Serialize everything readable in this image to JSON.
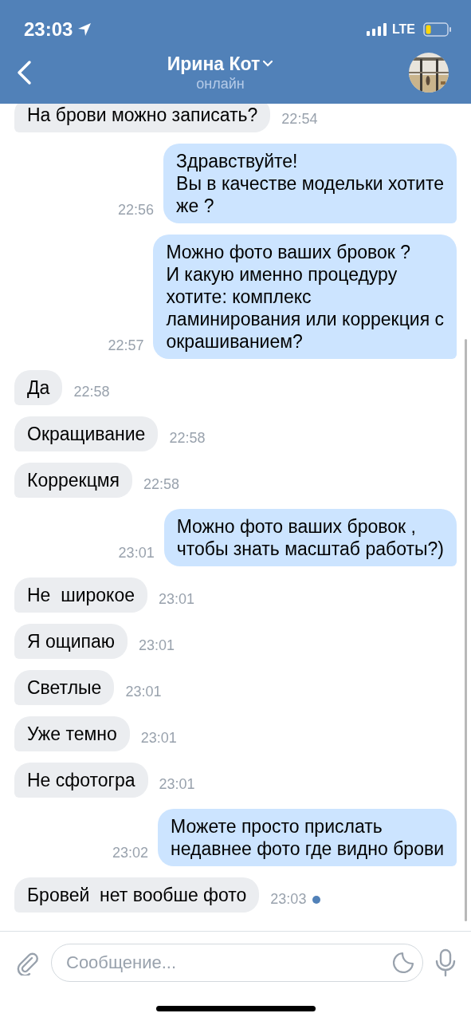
{
  "status_bar": {
    "time": "23:03",
    "network": "LTE"
  },
  "header": {
    "name": "Ирина Кот",
    "status": "онлайн"
  },
  "messages": [
    {
      "kind": "incoming",
      "text": "На брови можно записать?",
      "time": "22:54",
      "unread": false
    },
    {
      "kind": "outgoing",
      "text": "Здравствуйте!\nВы в качестве модельки хотите\nже ?",
      "time": "22:56",
      "unread": false
    },
    {
      "kind": "outgoing",
      "text": "Можно фото ваших бровок ?\nИ какую именно процедуру\nхотите: комплекс\nламинирования или коррекция с\nокрашиванием?",
      "time": "22:57",
      "unread": false
    },
    {
      "kind": "incoming",
      "text": "Да",
      "time": "22:58",
      "unread": false
    },
    {
      "kind": "incoming",
      "text": "Окращивание",
      "time": "22:58",
      "unread": false
    },
    {
      "kind": "incoming",
      "text": "Коррекцмя",
      "time": "22:58",
      "unread": false
    },
    {
      "kind": "outgoing",
      "text": "Можно фото ваших бровок ,\nчтобы знать масштаб работы?)",
      "time": "23:01",
      "unread": false
    },
    {
      "kind": "incoming",
      "text": "Не  широкое",
      "time": "23:01",
      "unread": false
    },
    {
      "kind": "incoming",
      "text": "Я ощипаю",
      "time": "23:01",
      "unread": false
    },
    {
      "kind": "incoming",
      "text": "Светлые",
      "time": "23:01",
      "unread": false
    },
    {
      "kind": "incoming",
      "text": "Уже темно",
      "time": "23:01",
      "unread": false
    },
    {
      "kind": "incoming",
      "text": "Не сфотогра",
      "time": "23:01",
      "unread": false
    },
    {
      "kind": "outgoing",
      "text": "Можете просто прислать\nнедавнее фото где видно брови",
      "time": "23:02",
      "unread": false
    },
    {
      "kind": "incoming",
      "text": "Бровей  нет вообше фото",
      "time": "23:03",
      "unread": true
    }
  ],
  "composer": {
    "placeholder": "Сообщение..."
  }
}
